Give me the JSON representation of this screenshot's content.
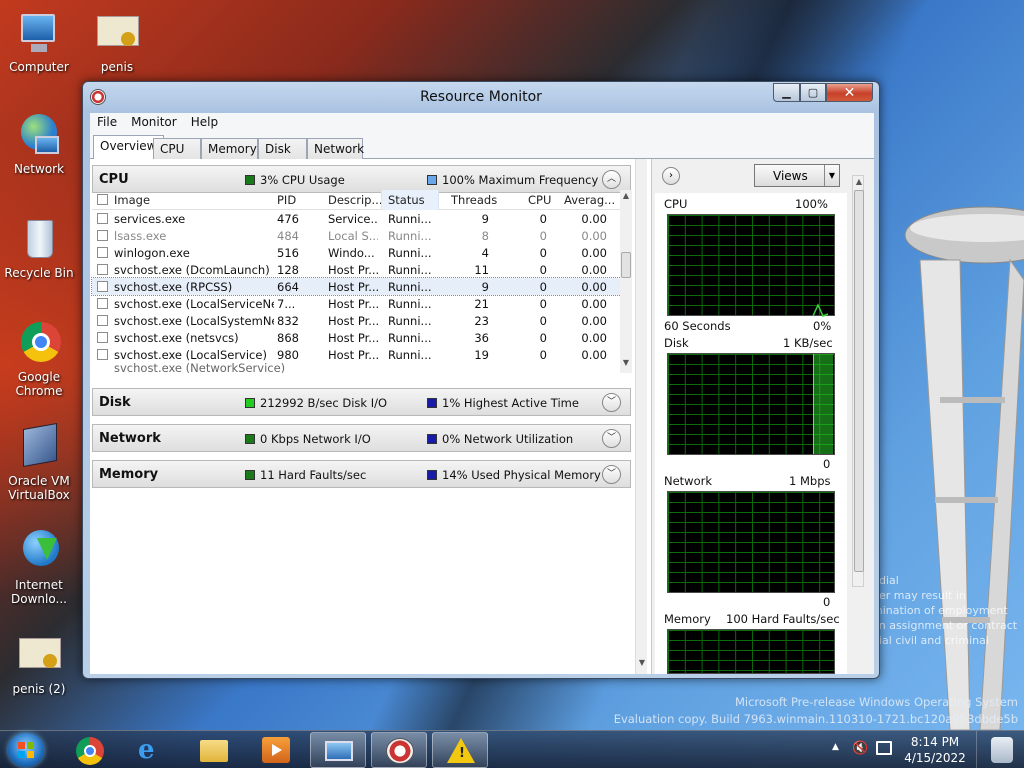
{
  "desktop": {
    "icons": [
      {
        "label": "Computer"
      },
      {
        "label": "penis"
      },
      {
        "label": "Network"
      },
      {
        "label": "Recycle Bin"
      },
      {
        "label": "Google Chrome"
      },
      {
        "label": "Oracle VM VirtualBox"
      },
      {
        "label": "Internet Downlo..."
      },
      {
        "label": "penis (2)"
      }
    ],
    "watermark_line1": "Microsoft Pre-release Windows Operating System",
    "watermark_line2": "Evaluation copy. Build 7963.winmain.110310-1721.bc120a9b3dbde5b",
    "confidential": [
      "ndial",
      "ner may result in",
      "mination of employment",
      "an assignment or contract",
      "nial civil and criminal"
    ]
  },
  "window": {
    "title": "Resource Monitor",
    "menu": [
      "File",
      "Monitor",
      "Help"
    ],
    "tabs": [
      "Overview",
      "CPU",
      "Memory",
      "Disk",
      "Network"
    ],
    "active_tab": "Overview"
  },
  "cpu": {
    "title": "CPU",
    "ind1": "3% CPU Usage",
    "ind1_color": "#1a7a1a",
    "ind2": "100% Maximum Frequency",
    "ind2_color": "#6aa6e8",
    "columns": [
      "Image",
      "PID",
      "Descrip...",
      "Status",
      "Threads",
      "CPU",
      "Averag..."
    ],
    "rows": [
      {
        "image": "services.exe",
        "pid": "476",
        "desc": "Service...",
        "status": "Runni...",
        "threads": "9",
        "cpu": "0",
        "avg": "0.00"
      },
      {
        "image": "lsass.exe",
        "pid": "484",
        "desc": "Local S...",
        "status": "Runni...",
        "threads": "8",
        "cpu": "0",
        "avg": "0.00"
      },
      {
        "image": "winlogon.exe",
        "pid": "516",
        "desc": "Windo...",
        "status": "Runni...",
        "threads": "4",
        "cpu": "0",
        "avg": "0.00"
      },
      {
        "image": "svchost.exe (DcomLaunch)",
        "pid": "128",
        "desc": "Host Pr...",
        "status": "Runni...",
        "threads": "11",
        "cpu": "0",
        "avg": "0.00"
      },
      {
        "image": "svchost.exe (RPCSS)",
        "pid": "664",
        "desc": "Host Pr...",
        "status": "Runni...",
        "threads": "9",
        "cpu": "0",
        "avg": "0.00"
      },
      {
        "image": "svchost.exe (LocalServiceNet...",
        "pid": "7...",
        "desc": "Host Pr...",
        "status": "Runni...",
        "threads": "21",
        "cpu": "0",
        "avg": "0.00"
      },
      {
        "image": "svchost.exe (LocalSystemNet...",
        "pid": "832",
        "desc": "Host Pr...",
        "status": "Runni...",
        "threads": "23",
        "cpu": "0",
        "avg": "0.00"
      },
      {
        "image": "svchost.exe (netsvcs)",
        "pid": "868",
        "desc": "Host Pr...",
        "status": "Runni...",
        "threads": "36",
        "cpu": "0",
        "avg": "0.00"
      },
      {
        "image": "svchost.exe (LocalService)",
        "pid": "980",
        "desc": "Host Pr...",
        "status": "Runni...",
        "threads": "19",
        "cpu": "0",
        "avg": "0.00"
      }
    ]
  },
  "disk": {
    "title": "Disk",
    "ind1": "212992 B/sec Disk I/O",
    "ind1_color": "#22cc22",
    "ind2": "1% Highest Active Time",
    "ind2_color": "#1a1aa8"
  },
  "network": {
    "title": "Network",
    "ind1": "0 Kbps Network I/O",
    "ind1_color": "#1a7a1a",
    "ind2": "0% Network Utilization",
    "ind2_color": "#1a1aa8"
  },
  "memory": {
    "title": "Memory",
    "ind1": "11 Hard Faults/sec",
    "ind1_color": "#1a7a1a",
    "ind2": "14% Used Physical Memory",
    "ind2_color": "#1a1aa8"
  },
  "graphs": {
    "views_label": "Views",
    "cpu": {
      "label": "CPU",
      "max": "100%",
      "time": "60 Seconds",
      "min": "0%"
    },
    "disk": {
      "label": "Disk",
      "max": "1 KB/sec",
      "min": "0"
    },
    "network": {
      "label": "Network",
      "max": "1 Mbps",
      "min": "0"
    },
    "memory": {
      "label": "Memory",
      "max": "100 Hard Faults/sec"
    }
  },
  "taskbar": {
    "time": "8:14 PM",
    "date": "4/15/2022"
  }
}
